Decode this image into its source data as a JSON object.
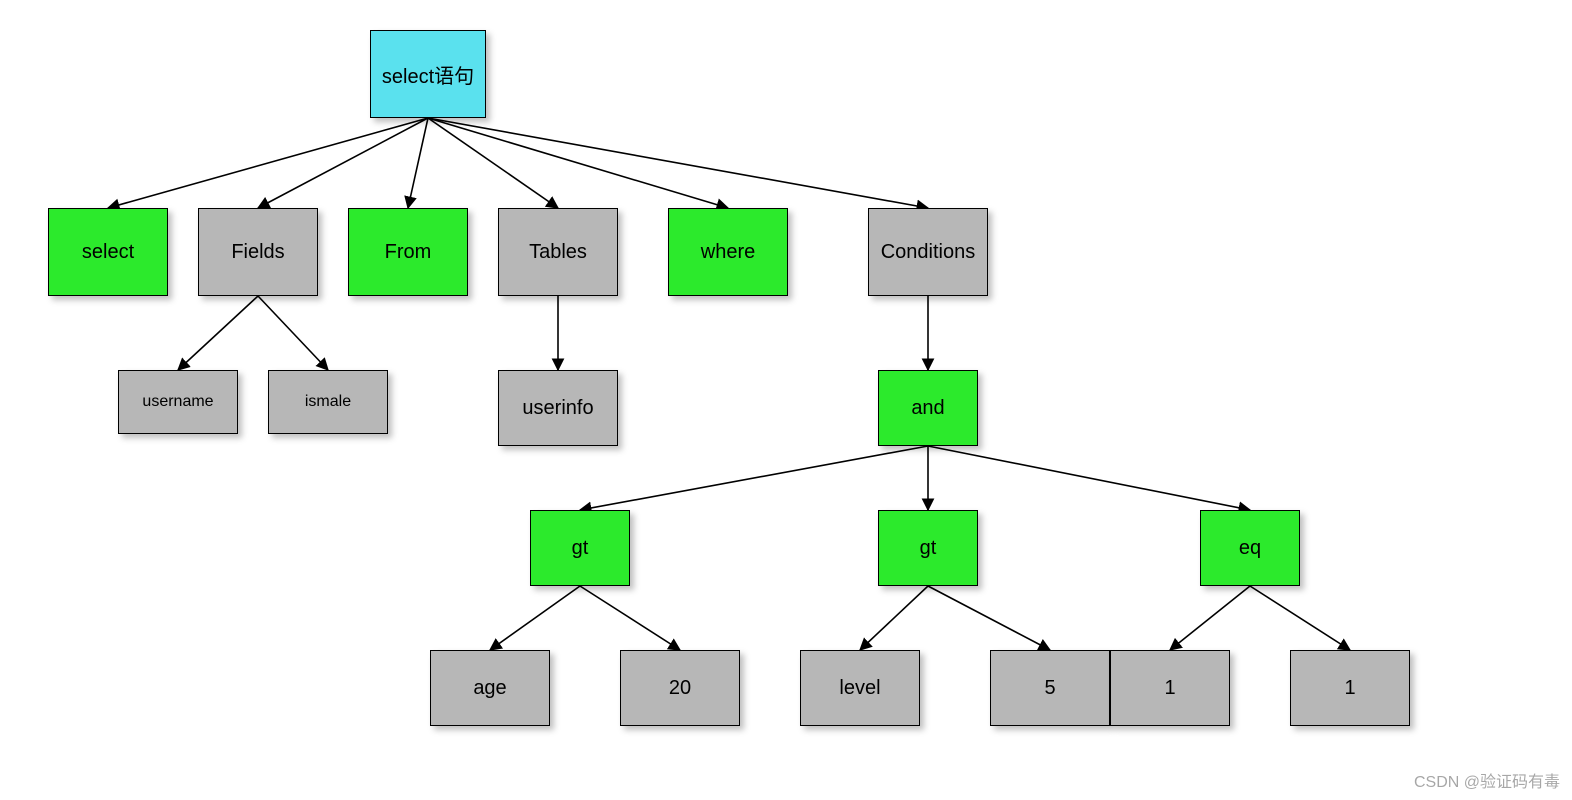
{
  "diagram": {
    "root": {
      "label": "select语句"
    },
    "row1": {
      "select": {
        "label": "select"
      },
      "fields": {
        "label": "Fields"
      },
      "from": {
        "label": "From"
      },
      "tables": {
        "label": "Tables"
      },
      "where": {
        "label": "where"
      },
      "conditions": {
        "label": "Conditions"
      }
    },
    "row2_fields": {
      "username": {
        "label": "username"
      },
      "ismale": {
        "label": "ismale"
      }
    },
    "row2_tables": {
      "userinfo": {
        "label": "userinfo"
      }
    },
    "row2_conditions": {
      "and": {
        "label": "and"
      }
    },
    "row3_and": {
      "gt1": {
        "label": "gt"
      },
      "gt2": {
        "label": "gt"
      },
      "eq": {
        "label": "eq"
      }
    },
    "row4_gt1": {
      "age": {
        "label": "age"
      },
      "v20": {
        "label": "20"
      }
    },
    "row4_gt2": {
      "level": {
        "label": "level"
      },
      "v5": {
        "label": "5"
      }
    },
    "row4_eq": {
      "one_a": {
        "label": "1"
      },
      "one_b": {
        "label": "1"
      }
    }
  },
  "watermark": "CSDN @验证码有毒"
}
